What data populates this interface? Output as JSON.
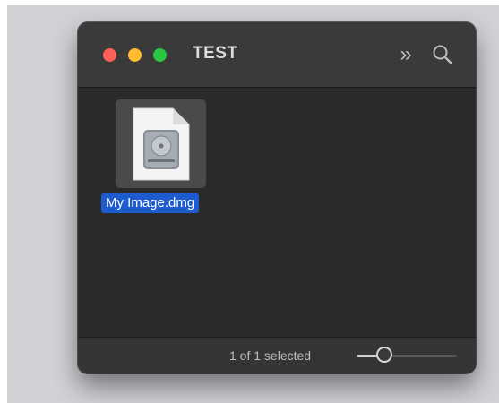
{
  "window": {
    "title": "TEST",
    "toolbar": {
      "overflow_icon": "chevron-double-right-icon",
      "search_icon": "search-icon"
    },
    "traffic_lights": [
      {
        "name": "close",
        "color": "#fe5f57"
      },
      {
        "name": "minimize",
        "color": "#febc2e"
      },
      {
        "name": "zoom",
        "color": "#28c840"
      }
    ]
  },
  "content": {
    "items": [
      {
        "name": "My Image.dmg",
        "icon": "disk-image-icon",
        "selected": true
      }
    ]
  },
  "status_bar": {
    "text": "1 of 1 selected",
    "icon_size_slider": {
      "value": 0.28
    }
  },
  "colors": {
    "selection": "#1f5bd0",
    "window_bg": "#2d2d2d"
  }
}
